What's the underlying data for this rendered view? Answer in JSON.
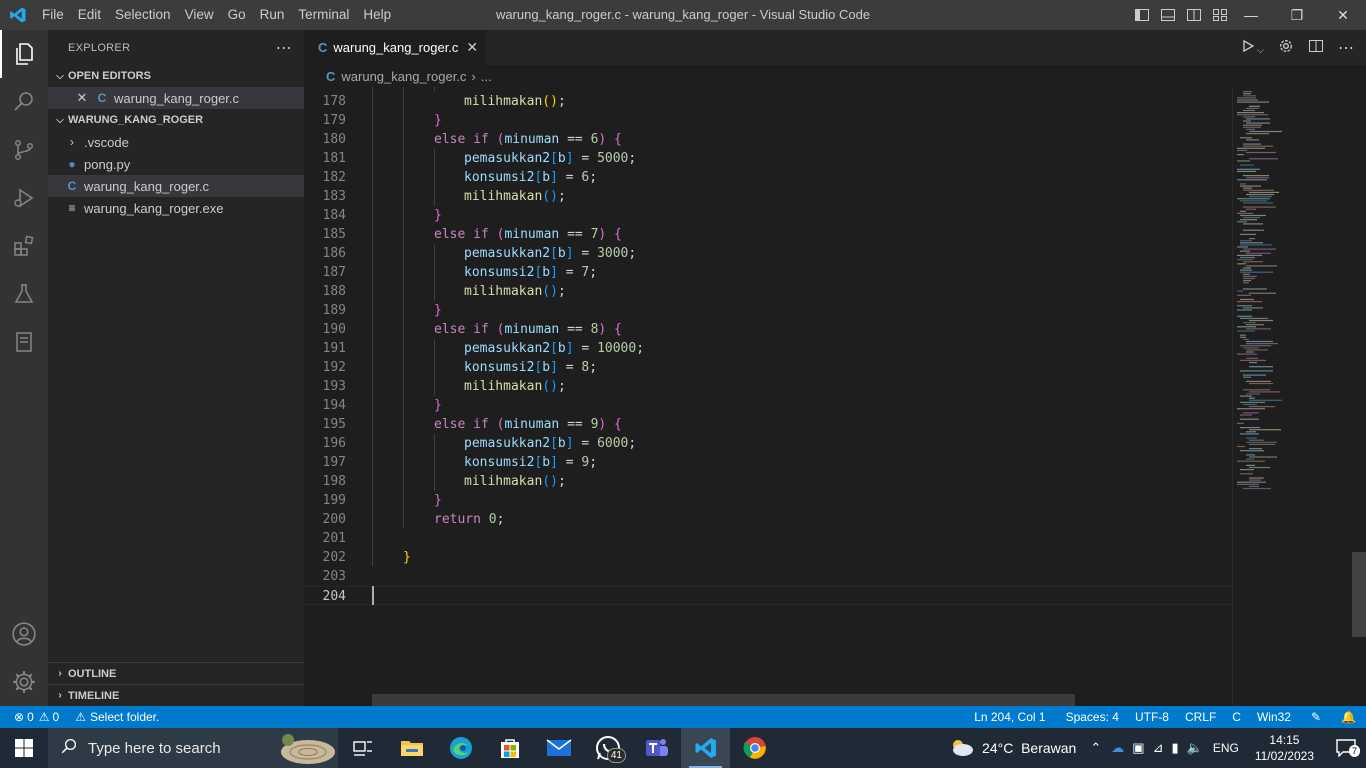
{
  "titlebar": {
    "menu": [
      "File",
      "Edit",
      "Selection",
      "View",
      "Go",
      "Run",
      "Terminal",
      "Help"
    ],
    "window_title": "warung_kang_roger.c - warung_kang_roger - Visual Studio Code"
  },
  "sidebar": {
    "header": "EXPLORER",
    "open_editors_label": "OPEN EDITORS",
    "open_editor_file": "warung_kang_roger.c",
    "workspace_label": "WARUNG_KANG_ROGER",
    "files": [
      {
        "name": ".vscode",
        "type": "folder"
      },
      {
        "name": "pong.py",
        "type": "python"
      },
      {
        "name": "warung_kang_roger.c",
        "type": "c"
      },
      {
        "name": "warung_kang_roger.exe",
        "type": "exe"
      }
    ],
    "outline_label": "OUTLINE",
    "timeline_label": "TIMELINE"
  },
  "editor": {
    "tab_label": "warung_kang_roger.c",
    "breadcrumb_file": "warung_kang_roger.c",
    "breadcrumb_more": "...",
    "lines": [
      {
        "n": "178",
        "code": "milihmakan();"
      },
      {
        "n": "179",
        "code": "}"
      },
      {
        "n": "180",
        "code": "else if (minuman == 6) {"
      },
      {
        "n": "181",
        "code": "pemasukkan2[b] = 5000;"
      },
      {
        "n": "182",
        "code": "konsumsi2[b] = 6;"
      },
      {
        "n": "183",
        "code": "milihmakan();"
      },
      {
        "n": "184",
        "code": "}"
      },
      {
        "n": "185",
        "code": "else if (minuman == 7) {"
      },
      {
        "n": "186",
        "code": "pemasukkan2[b] = 3000;"
      },
      {
        "n": "187",
        "code": "konsumsi2[b] = 7;"
      },
      {
        "n": "188",
        "code": "milihmakan();"
      },
      {
        "n": "189",
        "code": "}"
      },
      {
        "n": "190",
        "code": "else if (minuman == 8) {"
      },
      {
        "n": "191",
        "code": "pemasukkan2[b] = 10000;"
      },
      {
        "n": "192",
        "code": "konsumsi2[b] = 8;"
      },
      {
        "n": "193",
        "code": "milihmakan();"
      },
      {
        "n": "194",
        "code": "}"
      },
      {
        "n": "195",
        "code": "else if (minuman == 9) {"
      },
      {
        "n": "196",
        "code": "pemasukkan2[b] = 6000;"
      },
      {
        "n": "197",
        "code": "konsumsi2[b] = 9;"
      },
      {
        "n": "198",
        "code": "milihmakan();"
      },
      {
        "n": "199",
        "code": "}"
      },
      {
        "n": "200",
        "code": "return 0;"
      },
      {
        "n": "201",
        "code": ""
      },
      {
        "n": "202",
        "code": "}"
      },
      {
        "n": "203",
        "code": ""
      },
      {
        "n": "204",
        "code": ""
      }
    ]
  },
  "statusbar": {
    "errors": "0",
    "warnings": "0",
    "select_folder": "Select folder.",
    "position": "Ln 204, Col 1",
    "spaces": "Spaces: 4",
    "encoding": "UTF-8",
    "eol": "CRLF",
    "language": "C",
    "platform": "Win32"
  },
  "taskbar": {
    "search_placeholder": "Type here to search",
    "whatsapp_badge": "41",
    "weather": "24°C  Berawan",
    "language": "ENG",
    "time": "14:15",
    "date": "11/02/2023",
    "notification_count": "7"
  },
  "colors": {
    "accent": "#007acc",
    "titlebar": "#3c3c3c",
    "sidebar": "#252526",
    "editor_bg": "#1e1e1e"
  }
}
